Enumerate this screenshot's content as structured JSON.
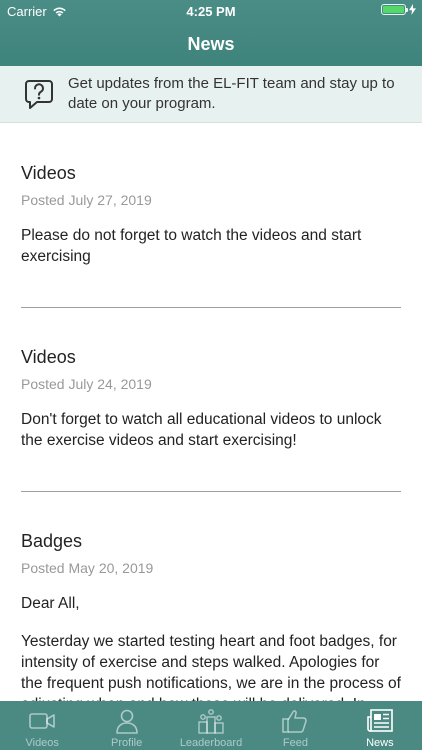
{
  "status_bar": {
    "carrier": "Carrier",
    "time": "4:25 PM",
    "battery_level": 1.0
  },
  "nav": {
    "title": "News"
  },
  "banner": {
    "text": "Get updates from the EL-FIT team and stay up to date on your program."
  },
  "posts": [
    {
      "title": "Videos",
      "date": "Posted July 27, 2019",
      "body": [
        "Please do not forget to watch the videos and start exercising"
      ]
    },
    {
      "title": "Videos",
      "date": "Posted July 24, 2019",
      "body": [
        "Don't forget to watch all educational videos to unlock the exercise videos and start exercising!"
      ]
    },
    {
      "title": "Badges",
      "date": "Posted May 20, 2019",
      "body": [
        "Dear All,",
        "Yesterday we started testing heart and foot badges, for intensity of exercise and steps walked. Apologies for the frequent push notifications, we are in the process of adjusting when and how these will be delivered. In principle, you get a heart badge if you do at least 30 min of moderate intensity"
      ]
    }
  ],
  "tabs": [
    {
      "label": "Videos",
      "icon": "video-camera-icon",
      "active": false
    },
    {
      "label": "Profile",
      "icon": "profile-icon",
      "active": false
    },
    {
      "label": "Leaderboard",
      "icon": "leaderboard-icon",
      "active": false
    },
    {
      "label": "Feed",
      "icon": "thumbs-up-icon",
      "active": false
    },
    {
      "label": "News",
      "icon": "newspaper-icon",
      "active": true
    }
  ],
  "colors": {
    "header": "#4a8d86",
    "tabbar": "#4a8a83",
    "banner": "#e7f1ef",
    "battery": "#54d86a"
  }
}
